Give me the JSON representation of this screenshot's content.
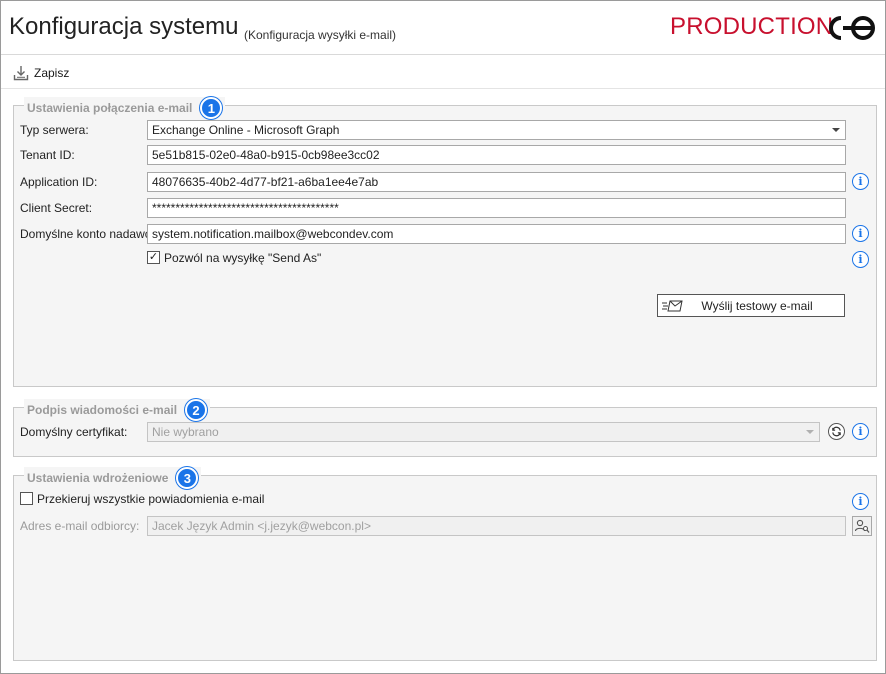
{
  "header": {
    "title": "Konfiguracja systemu",
    "subtitle": "(Konfiguracja wysyłki e-mail)",
    "environment": "PRODUCTION",
    "environment_color": "#c8102e"
  },
  "toolbar": {
    "save_label": "Zapisz",
    "save_icon": "save-download-icon"
  },
  "connection_settings": {
    "legend": "Ustawienia połączenia e-mail",
    "badge": "1",
    "server_type": {
      "label": "Typ serwera:",
      "value": "Exchange Online - Microsoft Graph"
    },
    "tenant_id": {
      "label": "Tenant ID:",
      "value": "5e51b815-02e0-48a0-b915-0cb98ee3cc02"
    },
    "application_id": {
      "label": "Application ID:",
      "value": "48076635-40b2-4d77-bf21-a6ba1ee4e7ab"
    },
    "client_secret": {
      "label": "Client Secret:",
      "value": "****************************************"
    },
    "default_sender": {
      "label": "Domyślne konto nadawcy:",
      "value": "system.notification.mailbox@webcondev.com"
    },
    "send_as": {
      "label": "Pozwól na wysyłkę \"Send As\"",
      "checked": true
    },
    "test_button_label": "Wyślij testowy e-mail"
  },
  "signature": {
    "legend": "Podpis wiadomości e-mail",
    "badge": "2",
    "certificate": {
      "label": "Domyślny certyfikat:",
      "value": "Nie wybrano"
    }
  },
  "deployment": {
    "legend": "Ustawienia wdrożeniowe",
    "badge": "3",
    "redirect": {
      "label": "Przekieruj wszystkie powiadomienia e-mail",
      "checked": false
    },
    "recipient": {
      "label": "Adres e-mail odbiorcy:",
      "value": "Jacek Język Admin <j.jezyk@webcon.pl>"
    }
  },
  "colors": {
    "accent": "#1a74e8",
    "group_background": "#f5f5f5",
    "legend_text": "#9a9a9a"
  }
}
